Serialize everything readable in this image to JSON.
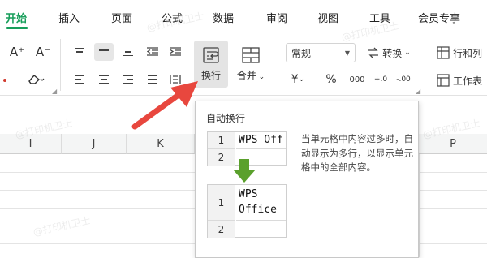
{
  "tabs": [
    "开始",
    "插入",
    "页面",
    "公式",
    "数据",
    "审阅",
    "视图",
    "工具",
    "会员专享"
  ],
  "ribbon": {
    "font_grow": "A⁺",
    "font_shrink": "A⁻",
    "wrap_text_label": "换行",
    "merge_label": "合并",
    "number_format_value": "常规",
    "convert_label": "转换",
    "rows_cols_label": "行和列",
    "worksheet_label": "工作表",
    "currency_symbol": "¥",
    "percent_symbol": "%",
    "thousands_symbol": "000",
    "inc_decimal_symbol": "+.0",
    "dec_decimal_symbol": "-.00"
  },
  "columns": [
    "I",
    "J",
    "K",
    "P"
  ],
  "tooltip": {
    "title": "自动换行",
    "description": "当单元格中内容过多时，自动显示为多行，以显示单元格中的全部内容。",
    "before": {
      "row1": "1",
      "row2": "2",
      "cell_text": "WPS Off"
    },
    "after": {
      "row1": "1",
      "row2": "2",
      "cell_line1": "WPS",
      "cell_line2": "Office"
    }
  },
  "watermark": "@打印机卫士",
  "colors": {
    "accent_green": "#179e5a",
    "arrow_red": "#e8473e",
    "demo_arrow_green": "#5aa02c"
  }
}
